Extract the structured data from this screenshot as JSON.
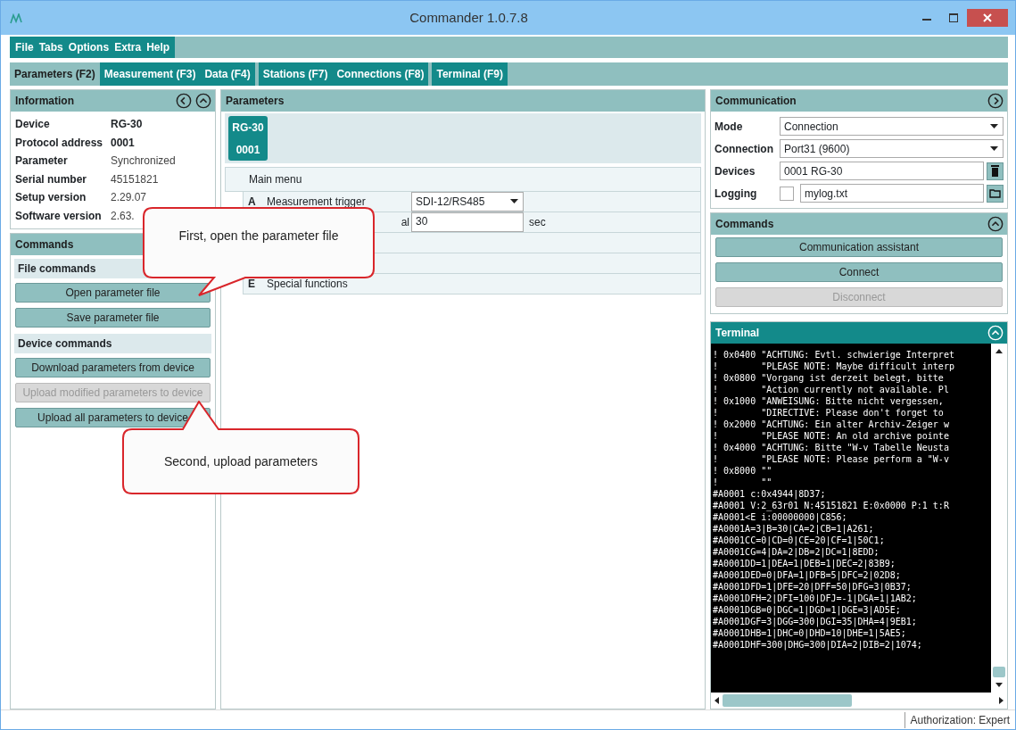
{
  "window": {
    "title": "Commander 1.0.7.8"
  },
  "menu": [
    "File",
    "Tabs",
    "Options",
    "Extra",
    "Help"
  ],
  "tab_groups": [
    [
      {
        "label": "Parameters (F2)",
        "selected": true
      },
      {
        "label": "Measurement (F3)",
        "selected": false
      },
      {
        "label": "Data (F4)",
        "selected": false
      }
    ],
    [
      {
        "label": "Stations (F7)",
        "selected": false
      },
      {
        "label": "Connections (F8)",
        "selected": false
      }
    ],
    [
      {
        "label": "Terminal (F9)",
        "selected": false
      }
    ]
  ],
  "information": {
    "title": "Information",
    "rows": [
      {
        "label": "Device",
        "value": "RG-30",
        "emphasis": true
      },
      {
        "label": "Protocol address",
        "value": "0001",
        "emphasis": true
      },
      {
        "label": "Parameter",
        "value": "Synchronized",
        "emphasis": false
      },
      {
        "label": "Serial number",
        "value": "45151821",
        "emphasis": false
      },
      {
        "label": "Setup version",
        "value": "2.29.07",
        "emphasis": false
      },
      {
        "label": "Software version",
        "value": "2.63.",
        "emphasis": false
      }
    ]
  },
  "commands_left": {
    "title": "Commands",
    "sections": [
      {
        "title": "File commands",
        "buttons": [
          {
            "label": "Open parameter file",
            "disabled": false
          },
          {
            "label": "Save parameter file",
            "disabled": false
          }
        ]
      },
      {
        "title": "Device commands",
        "buttons": [
          {
            "label": "Download parameters from device",
            "disabled": false
          },
          {
            "label": "Upload modified parameters to device",
            "disabled": true
          },
          {
            "label": "Upload all parameters to device",
            "disabled": false
          }
        ]
      }
    ]
  },
  "parameters": {
    "title": "Parameters",
    "device": {
      "name": "RG-30",
      "address": "0001"
    },
    "menu_title": "Main menu",
    "rows": [
      {
        "kind": "select",
        "key": "A",
        "label": "Measurement trigger",
        "value": "SDI-12/RS485"
      },
      {
        "kind": "input",
        "label": "al",
        "value": "30",
        "unit": "sec"
      },
      {
        "kind": "empty"
      },
      {
        "kind": "empty"
      },
      {
        "kind": "plain",
        "key": "E",
        "label": "Special functions"
      }
    ]
  },
  "communication": {
    "title": "Communication",
    "fields": [
      {
        "kind": "select",
        "label": "Mode",
        "value": "Connection"
      },
      {
        "kind": "select",
        "label": "Connection",
        "value": "Port31 (9600)"
      },
      {
        "kind": "delete",
        "label": "Devices",
        "value": "0001 RG-30"
      },
      {
        "kind": "log",
        "label": "Logging",
        "checked": false,
        "value": "mylog.txt"
      }
    ]
  },
  "commands_right": {
    "title": "Commands",
    "buttons": [
      {
        "label": "Communication assistant",
        "disabled": false
      },
      {
        "label": "Connect",
        "disabled": false
      },
      {
        "label": "Disconnect",
        "disabled": true
      }
    ]
  },
  "terminal": {
    "title": "Terminal",
    "lines": [
      "! 0x0400 \"ACHTUNG: Evtl. schwierige Interpret",
      "!        \"PLEASE NOTE: Maybe difficult interp",
      "! 0x0800 \"Vorgang ist derzeit belegt, bitte",
      "!        \"Action currently not available. Pl",
      "! 0x1000 \"ANWEISUNG: Bitte nicht vergessen,",
      "!        \"DIRECTIVE: Please don't forget to",
      "! 0x2000 \"ACHTUNG: Ein alter Archiv-Zeiger w",
      "!        \"PLEASE NOTE: An old archive pointe",
      "! 0x4000 \"ACHTUNG: Bitte \"W-v Tabelle Neusta",
      "!        \"PLEASE NOTE: Please perform a \"W-v",
      "! 0x8000 \"\"",
      "!        \"\"",
      "#A0001 c:0x4944|8D37;",
      "#A0001 V:2_63r01 N:45151821 E:0x0000 P:1 t:R",
      "#A0001<E i:00000000|C856;",
      "#A0001A=3|B=30|CA=2|CB=1|A261;",
      "#A0001CC=0|CD=0|CE=20|CF=1|50C1;",
      "#A0001CG=4|DA=2|DB=2|DC=1|8EDD;",
      "#A0001DD=1|DEA=1|DEB=1|DEC=2|83B9;",
      "#A0001DED=0|DFA=1|DFB=5|DFC=2|02D8;",
      "#A0001DFD=1|DFE=20|DFF=50|DFG=3|0B37;",
      "#A0001DFH=2|DFI=100|DFJ=-1|DGA=1|1AB2;",
      "#A0001DGB=0|DGC=1|DGD=1|DGE=3|AD5E;",
      "#A0001DGF=3|DGG=300|DGI=35|DHA=4|9EB1;",
      "#A0001DHB=1|DHC=0|DHD=10|DHE=1|5AE5;",
      "#A0001DHF=300|DHG=300|DIA=2|DIB=2|1074;"
    ]
  },
  "callouts": [
    {
      "text": "First, open the parameter file"
    },
    {
      "text": "Second, upload parameters"
    }
  ],
  "status_bar": {
    "text": "Authorization: Expert"
  }
}
